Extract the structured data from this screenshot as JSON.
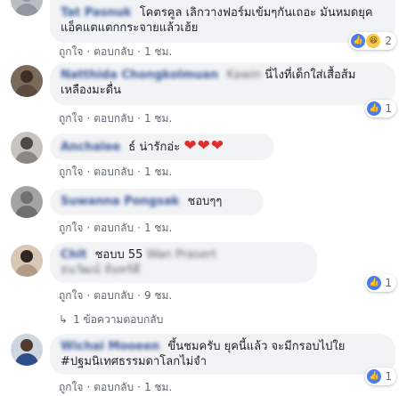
{
  "action_labels": {
    "like": "ถูกใจ",
    "reply": "ตอบกลับ"
  },
  "comments": [
    {
      "author": "Tat Pasnuk",
      "text": "โคตรคูล เลิกวางฟอร์มเข้มๆกันเถอะ มันหมดยุคแอ็คแตแตกกระจายแล้วเฮ้ย",
      "time": "1 ชม.",
      "reaction_count": "2"
    },
    {
      "author": "Natthida Chongkolmuan",
      "hidden_name": "Kawin",
      "text": "นี่ไงที่เด็กใส่เสื้อส้มเหลืองมะดื่น",
      "time": "1 ชม.",
      "reaction_count": "1"
    },
    {
      "author": "Anchalee",
      "text": "ธ์ น่ารักอ่ะ",
      "hearts": "❤❤❤",
      "time": "1 ชม.",
      "reaction_count": ""
    },
    {
      "author": "Suwanna Pongsak",
      "text": "ชอบๆๆ",
      "time": "1 ชม.",
      "reaction_count": ""
    },
    {
      "author": "Chit",
      "text": "ชอบบ 55",
      "hidden_name": "Wan Prasert",
      "subline": "ธนวัฒน์ จันทร์ดี",
      "time": "9 ชม.",
      "reaction_count": "1"
    },
    {
      "author": "Wichai Mooeen",
      "text": "ขึ้นชมครับ ยุคนี้แล้ว จะมีกรอบไปใย #ปฐมนิเทศธรรมดาโลกไม่จำ",
      "time": "1 ชม.",
      "reaction_count": "1"
    }
  ],
  "replies_link": "1 ข้อความตอบกลับ"
}
